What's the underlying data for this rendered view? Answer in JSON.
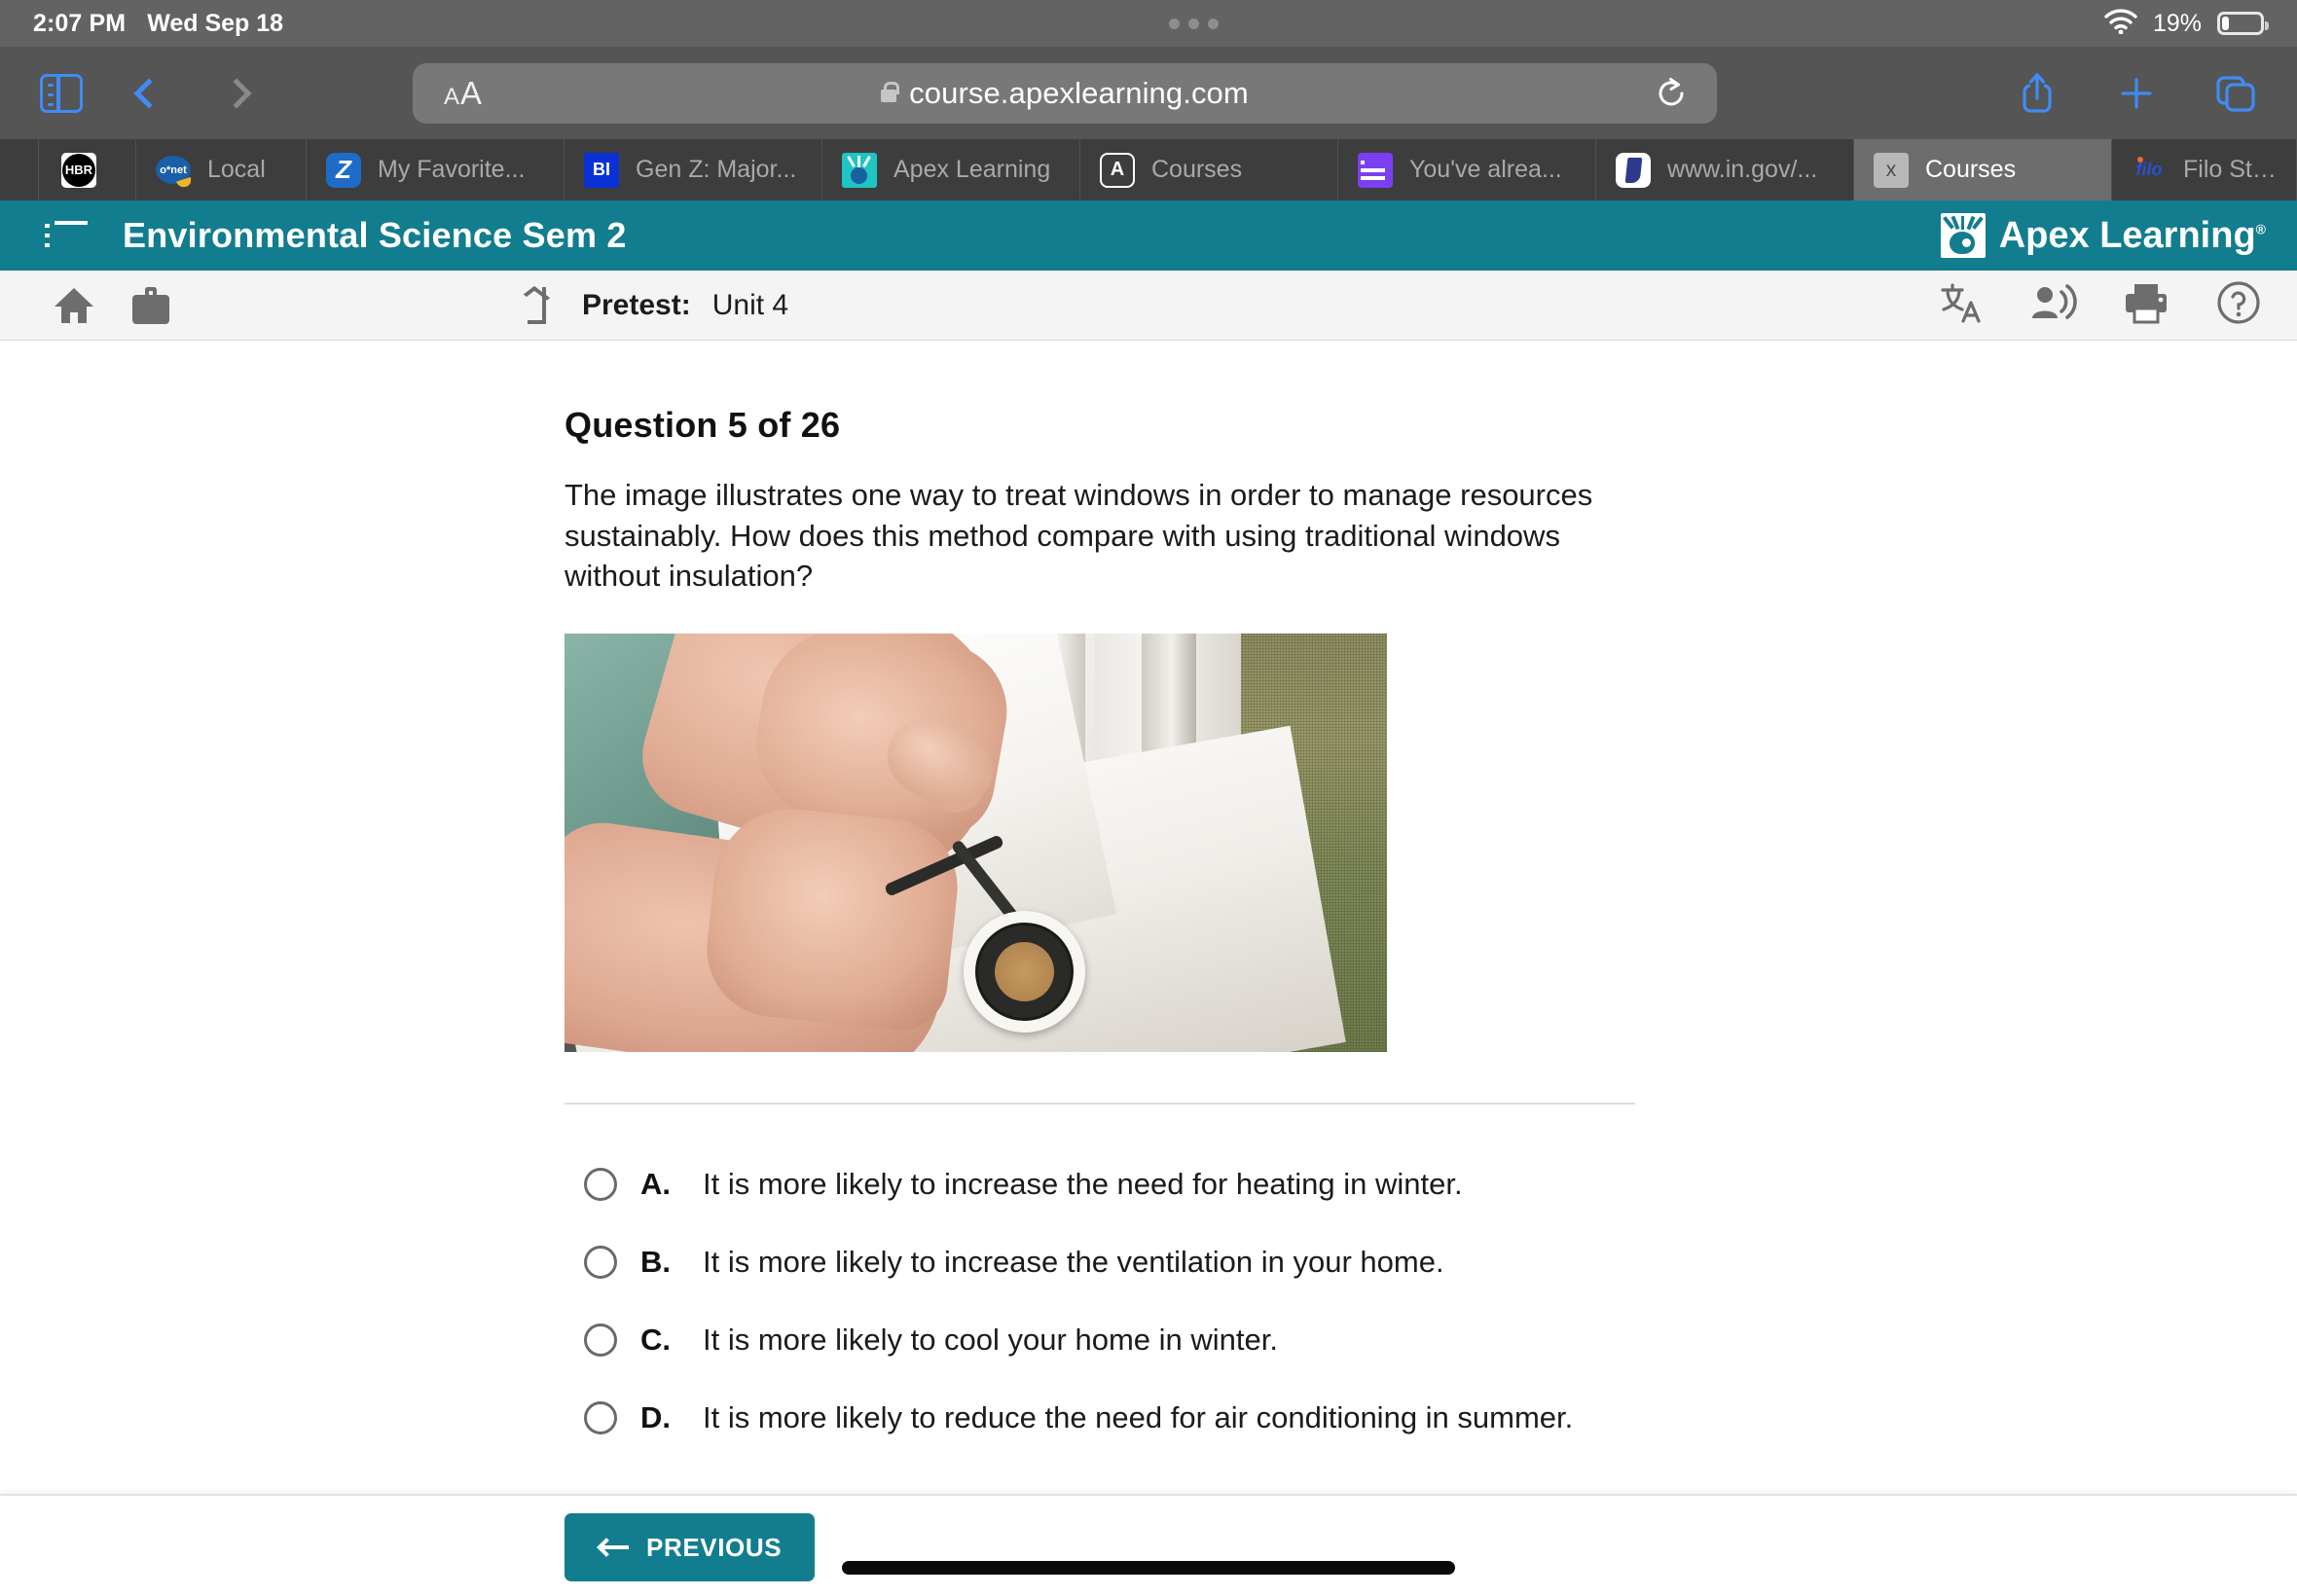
{
  "status_bar": {
    "time": "2:07 PM",
    "date": "Wed Sep 18",
    "battery_percent": "19%",
    "wifi_icon": "wifi-icon",
    "battery_icon": "battery-icon"
  },
  "browser": {
    "sidebar_icon": "sidebar-toggle-icon",
    "back_icon": "chevron-left-icon",
    "forward_icon": "chevron-right-icon",
    "reader_label_small": "A",
    "reader_label_large": "A",
    "lock_icon": "lock-icon",
    "url": "course.apexlearning.com",
    "reload_icon": "reload-icon",
    "share_icon": "share-icon",
    "new_tab_icon": "plus-icon",
    "tabs_overview_icon": "tabs-overview-icon",
    "tabs": [
      {
        "label": "",
        "favicon": "hbr-icon",
        "active": false
      },
      {
        "label": "Local",
        "favicon": "onet-icon",
        "active": false
      },
      {
        "label": "My Favorite...",
        "favicon": "zillow-icon",
        "active": false
      },
      {
        "label": "Gen Z: Major...",
        "favicon": "business-insider-icon",
        "active": false
      },
      {
        "label": "Apex Learning",
        "favicon": "apex-learning-icon",
        "active": false
      },
      {
        "label": "Courses",
        "favicon": "letter-a-icon",
        "active": false
      },
      {
        "label": "You've alrea...",
        "favicon": "list-icon",
        "active": false
      },
      {
        "label": "www.in.gov/...",
        "favicon": "indiana-gov-icon",
        "active": false
      },
      {
        "label": "Courses",
        "favicon": "x-icon",
        "active": true
      },
      {
        "label": "Filo Student:...",
        "favicon": "filo-icon",
        "active": false
      }
    ]
  },
  "app_header": {
    "menu_icon": "hamburger-menu-icon",
    "course_title": "Environmental Science Sem 2",
    "brand_name": "Apex Learning",
    "brand_trademark": "®",
    "brand_icon": "apex-learning-logo-icon",
    "background_color": "#127d8e"
  },
  "sub_toolbar": {
    "home_icon": "home-icon",
    "briefcase_icon": "briefcase-icon",
    "up_level_icon": "up-level-arrow-icon",
    "breadcrumb_label": "Pretest:",
    "breadcrumb_value": "Unit 4",
    "translate_icon": "translate-icon",
    "read_aloud_icon": "read-aloud-icon",
    "print_icon": "print-icon",
    "help_icon": "help-icon"
  },
  "question": {
    "heading": "Question 5 of 26",
    "prompt": "The image illustrates one way to treat windows in order to manage resources sustainably. How does this method compare with using traditional windows without insulation?",
    "image_alt": "Hands applying black foam weatherstripping tape around a window frame on a white window sill",
    "choices": [
      {
        "letter": "A.",
        "text": "It is more likely to increase the need for heating in winter.",
        "selected": false
      },
      {
        "letter": "B.",
        "text": "It is more likely to increase the ventilation in your home.",
        "selected": false
      },
      {
        "letter": "C.",
        "text": "It is more likely to cool your home in winter.",
        "selected": false
      },
      {
        "letter": "D.",
        "text": "It is more likely to reduce the need for air conditioning in summer.",
        "selected": false
      }
    ]
  },
  "footer": {
    "previous_label": "PREVIOUS",
    "previous_arrow_icon": "arrow-left-icon",
    "button_color": "#127d8e"
  }
}
